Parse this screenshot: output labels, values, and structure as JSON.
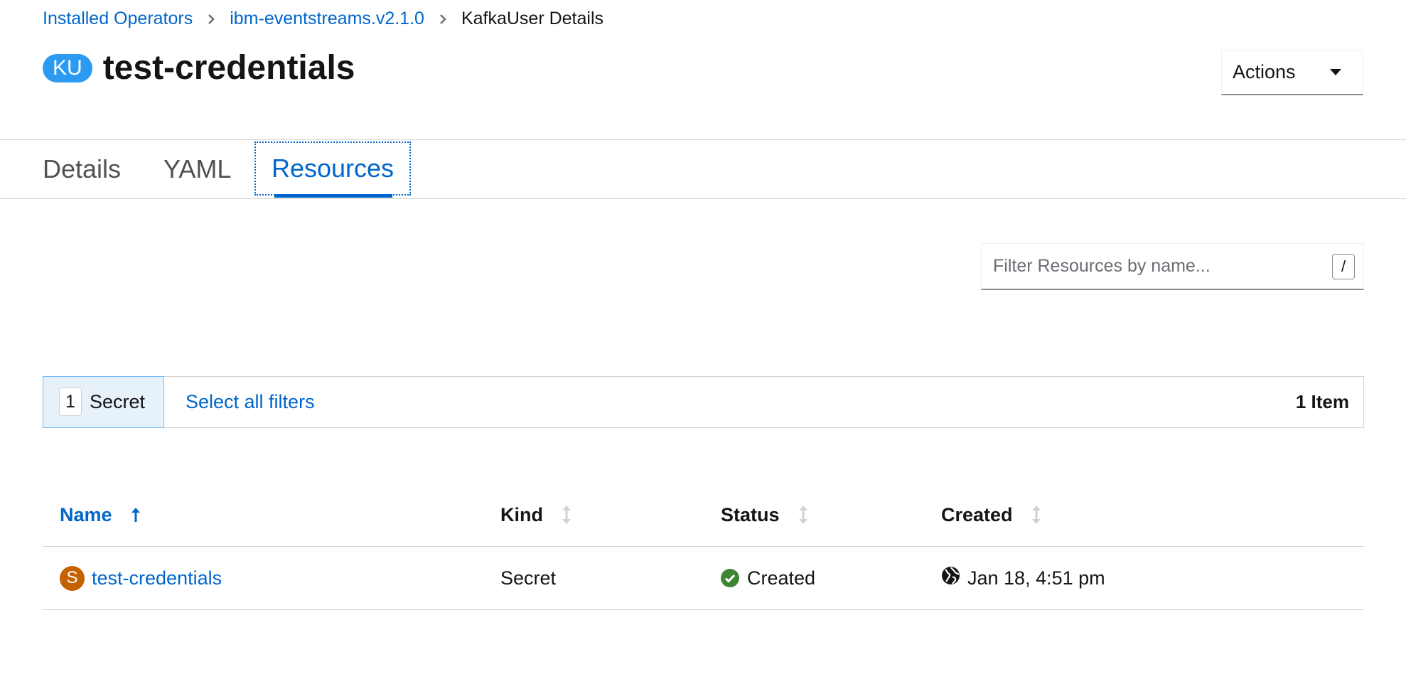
{
  "breadcrumb": {
    "items": [
      {
        "label": "Installed Operators"
      },
      {
        "label": "ibm-eventstreams.v2.1.0"
      },
      {
        "label": "KafkaUser Details"
      }
    ]
  },
  "header": {
    "badge": "KU",
    "title": "test-credentials",
    "actions_label": "Actions"
  },
  "tabs": [
    {
      "label": "Details",
      "active": false
    },
    {
      "label": "YAML",
      "active": false
    },
    {
      "label": "Resources",
      "active": true
    }
  ],
  "filter": {
    "placeholder": "Filter Resources by name...",
    "shortcut": "/"
  },
  "filter_bar": {
    "chip_count": "1",
    "chip_label": "Secret",
    "select_all": "Select all filters",
    "item_count": "1 Item"
  },
  "table": {
    "columns": [
      {
        "label": "Name",
        "sort": "ascending"
      },
      {
        "label": "Kind",
        "sort": "none"
      },
      {
        "label": "Status",
        "sort": "none"
      },
      {
        "label": "Created",
        "sort": "none"
      }
    ],
    "rows": [
      {
        "icon_letter": "S",
        "name": "test-credentials",
        "kind": "Secret",
        "status": "Created",
        "created": "Jan 18, 4:51 pm"
      }
    ]
  },
  "colors": {
    "link": "#0066cc",
    "badge_ku": "#2b9af3",
    "badge_secret": "#c46100",
    "status_ok": "#3e8635"
  },
  "icons": {
    "breadcrumb_separator": "chevron-right-icon",
    "actions": "caret-down-icon",
    "sort_active": "arrow-up-icon",
    "sort_inactive": "sort-arrows-icon",
    "status": "check-circle-icon",
    "created": "globe-icon"
  }
}
